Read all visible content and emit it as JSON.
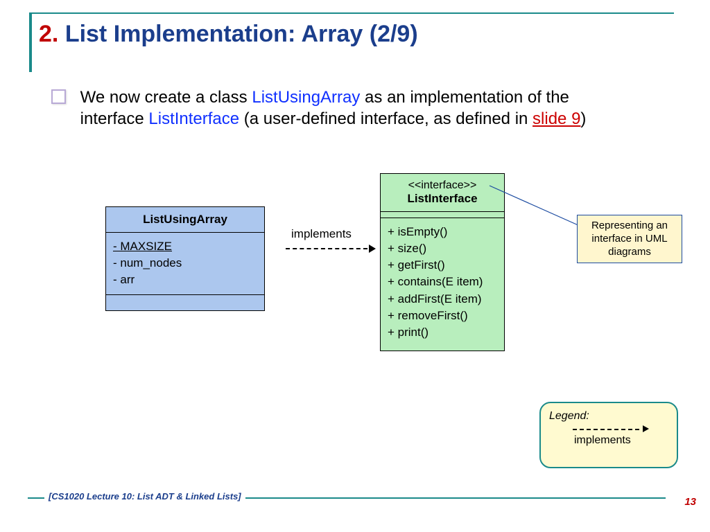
{
  "title": {
    "num": "2.",
    "rest": "List Implementation: Array (2/9)"
  },
  "bullet": {
    "t1": "We now create a class ",
    "c1": "ListUsingArray",
    "t2": " as an implementation of the interface ",
    "c2": "ListInterface",
    "t3": " (a user-defined interface, as defined in ",
    "link": "slide 9",
    "t4": ")"
  },
  "arrow_label": "implements",
  "left_box": {
    "name": "ListUsingArray",
    "attrs": [
      "- MAXSIZE",
      "- num_nodes",
      "- arr"
    ],
    "attrs_underline": [
      true,
      false,
      false
    ]
  },
  "right_box": {
    "stereo": "<<interface>>",
    "name": "ListInterface",
    "ops": [
      "+ isEmpty()",
      "+ size()",
      "+ getFirst()",
      "+ contains(E item)",
      "+ addFirst(E item)",
      "+ removeFirst()",
      "+ print()"
    ]
  },
  "note": {
    "l1": "Representing an",
    "l2": "interface in UML",
    "l3": "diagrams"
  },
  "legend": {
    "title": "Legend:",
    "word": "implements"
  },
  "footer": "[CS1020 Lecture 10: List ADT & Linked Lists]",
  "page": "13"
}
